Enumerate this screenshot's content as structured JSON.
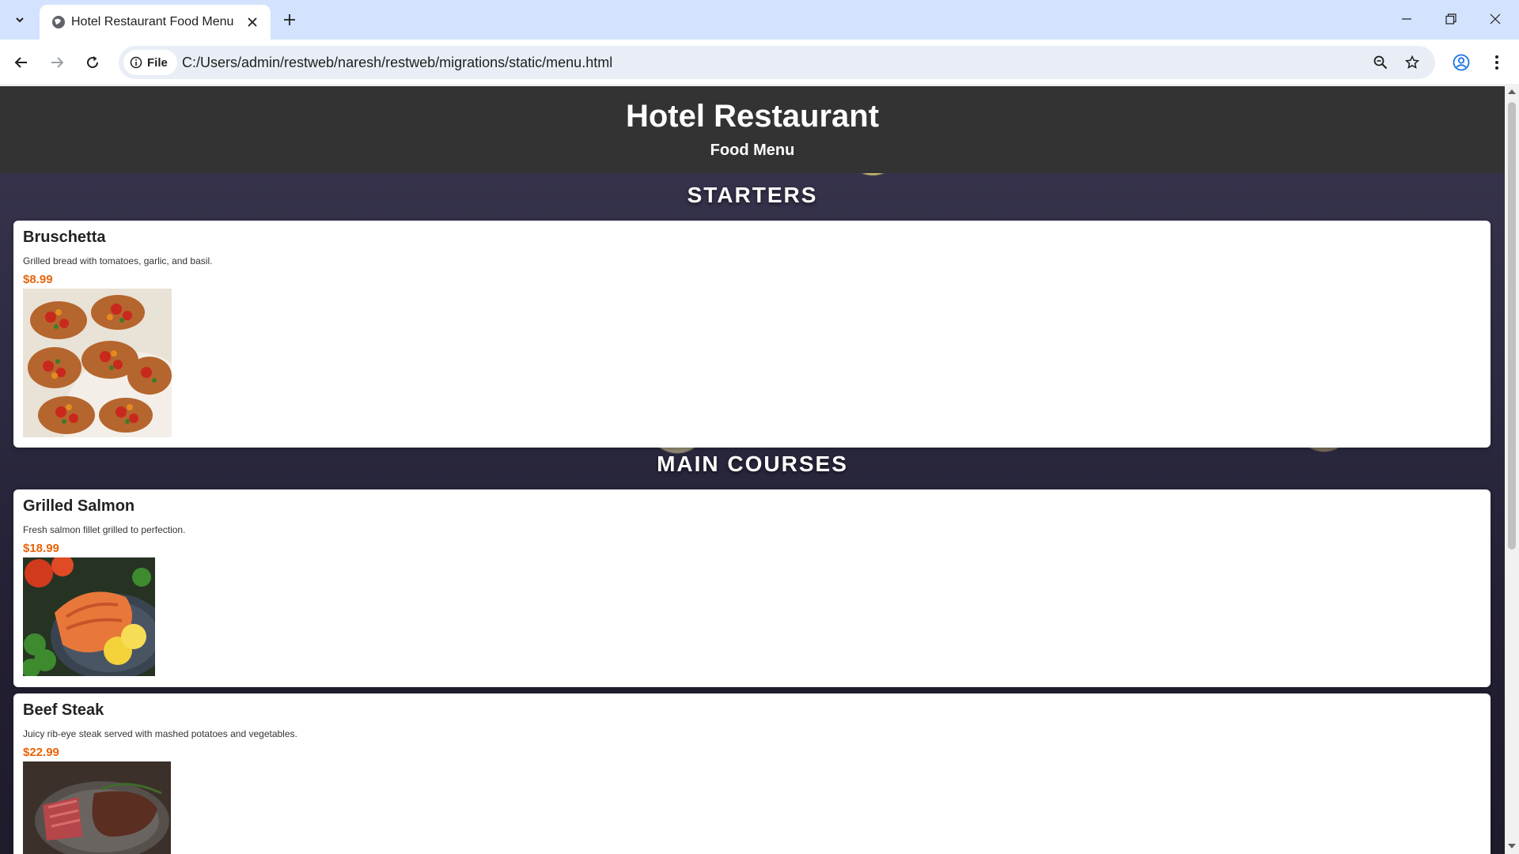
{
  "browser": {
    "tab_title": "Hotel Restaurant Food Menu",
    "chip_label": "File",
    "url": "C:/Users/admin/restweb/naresh/restweb/migrations/static/menu.html"
  },
  "page": {
    "title": "Hotel Restaurant",
    "subtitle": "Food Menu"
  },
  "sections": [
    {
      "heading": "STARTERS",
      "items": [
        {
          "name": "Bruschetta",
          "description": "Grilled bread with tomatoes, garlic, and basil.",
          "price": "$8.99"
        }
      ]
    },
    {
      "heading": "MAIN COURSES",
      "items": [
        {
          "name": "Grilled Salmon",
          "description": "Fresh salmon fillet grilled to perfection.",
          "price": "$18.99"
        },
        {
          "name": "Beef Steak",
          "description": "Juicy rib-eye steak served with mashed potatoes and vegetables.",
          "price": "$22.99"
        }
      ]
    }
  ],
  "colors": {
    "header_bg": "#333333",
    "price": "#e8630a",
    "tabstrip": "#d3e3fd"
  }
}
